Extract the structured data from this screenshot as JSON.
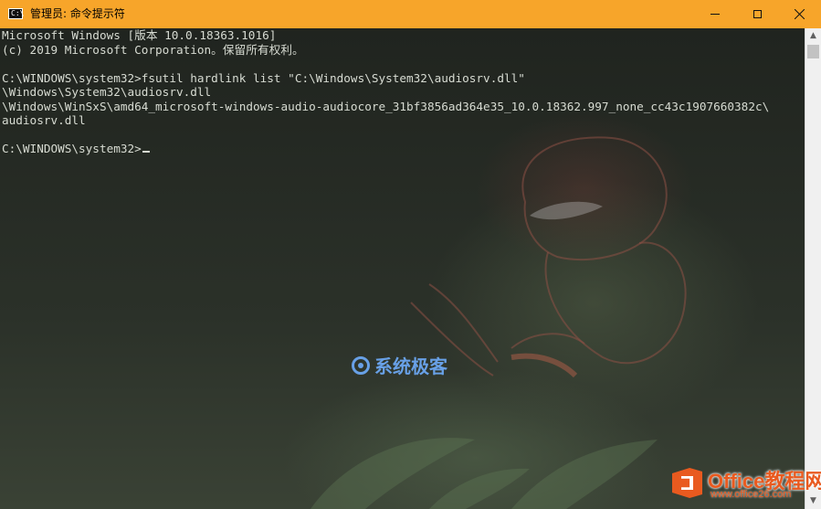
{
  "window": {
    "title": "管理员: 命令提示符",
    "icon": "cmd-app-icon",
    "icon_text": "C:\\",
    "controls": {
      "minimize": "minimize-icon",
      "maximize": "maximize-icon",
      "close": "close-icon"
    }
  },
  "console": {
    "lines": [
      "Microsoft Windows [版本 10.0.18363.1016]",
      "(c) 2019 Microsoft Corporation。保留所有权利。",
      "",
      "C:\\WINDOWS\\system32>fsutil hardlink list \"C:\\Windows\\System32\\audiosrv.dll\"",
      "\\Windows\\System32\\audiosrv.dll",
      "\\Windows\\WinSxS\\amd64_microsoft-windows-audio-audiocore_31bf3856ad364e35_10.0.18362.997_none_cc43c1907660382c\\",
      "audiosrv.dll",
      "",
      "C:\\WINDOWS\\system32>"
    ]
  },
  "watermark": {
    "text": "系统极客"
  },
  "branding": {
    "name": "Office教程网",
    "url": "www.office26.com"
  },
  "colors": {
    "titlebar": "#f7a52a",
    "text": "#d7dbd2",
    "brand": "#e95a1f"
  }
}
